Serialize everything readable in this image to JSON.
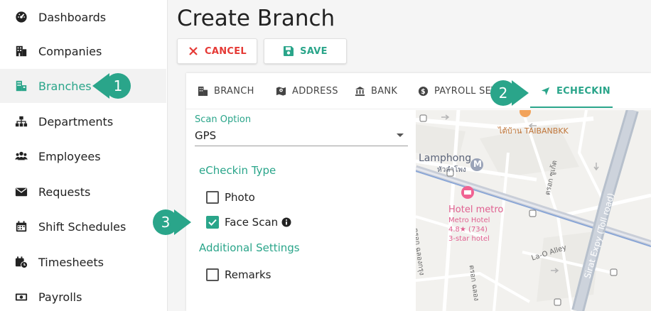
{
  "sidebar": {
    "items": [
      {
        "label": "Dashboards",
        "icon": "dashboard-icon"
      },
      {
        "label": "Companies",
        "icon": "building-icon"
      },
      {
        "label": "Branches",
        "icon": "branch-icon",
        "active": true
      },
      {
        "label": "Departments",
        "icon": "sitemap-icon"
      },
      {
        "label": "Employees",
        "icon": "users-icon"
      },
      {
        "label": "Requests",
        "icon": "envelope-icon"
      },
      {
        "label": "Shift Schedules",
        "icon": "calendar-icon"
      },
      {
        "label": "Timesheets",
        "icon": "calendar-clock-icon"
      },
      {
        "label": "Payrolls",
        "icon": "money-icon"
      }
    ]
  },
  "header": {
    "title": "Create Branch",
    "cancel_label": "CANCEL",
    "save_label": "SAVE"
  },
  "tabs": [
    {
      "label": "BRANCH",
      "icon": "building-icon"
    },
    {
      "label": "ADDRESS",
      "icon": "map-icon"
    },
    {
      "label": "BANK",
      "icon": "bank-icon"
    },
    {
      "label": "PAYROLL SET",
      "icon": "dollar-icon"
    },
    {
      "label": "ECHECKIN",
      "icon": "location-arrow-icon",
      "active": true
    }
  ],
  "form": {
    "scan_option_label": "Scan Option",
    "scan_option_value": "GPS",
    "echeckin_type_title": "eCheckin Type",
    "photo_label": "Photo",
    "photo_checked": false,
    "face_scan_label": "Face Scan",
    "face_scan_checked": true,
    "additional_settings_title": "Additional Settings",
    "remarks_label": "Remarks",
    "remarks_checked": false
  },
  "map": {
    "labels": {
      "taibanbkk": "ไต้บ้าน TAIBANBKK",
      "lamphong": "Lamphong",
      "lamphong_thai": "หัวลำโพง",
      "hotel_name": "Hotel metro",
      "hotel_name_2": "Metro Hotel",
      "hotel_rating": "4.8★ (734)",
      "hotel_class": "3-star hotel",
      "road_thai_1": "ตรอก ซูเก้ต",
      "road_thai_2": "ตรอก ฉลองกรุง",
      "road_thai_3": "ตรอก ฉลอง",
      "lao_alley": "La-O Alley",
      "sirat_expy": "Sirat Expy (Toll road)",
      "metro_letter": "M"
    }
  },
  "callouts": [
    "1",
    "2",
    "3"
  ],
  "colors": {
    "accent": "#2aa58a",
    "cancel": "#e53935",
    "active_bg": "#f2f2f2"
  }
}
